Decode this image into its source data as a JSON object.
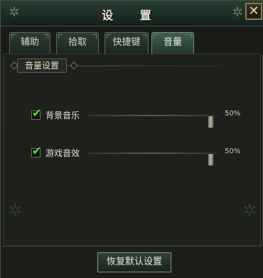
{
  "window": {
    "title": "设  置",
    "close_glyph": "✕",
    "ornament_glyph": "✲"
  },
  "tabs": [
    {
      "label": "辅助",
      "active": false
    },
    {
      "label": "拾取",
      "active": false
    },
    {
      "label": "快捷键",
      "active": false
    },
    {
      "label": "音量",
      "active": true
    }
  ],
  "section": {
    "label": "音量设置"
  },
  "settings": [
    {
      "label": "背景音乐",
      "checked": true,
      "value_text": "50%",
      "level": 0.5
    },
    {
      "label": "游戏音效",
      "checked": true,
      "value_text": "50%",
      "level": 0.5
    }
  ],
  "checkbox_glyph": "✔",
  "footer": {
    "restore_label": "恢复默认设置"
  },
  "colors": {
    "check": "#4de04a",
    "accent_green": "#3f6050"
  }
}
